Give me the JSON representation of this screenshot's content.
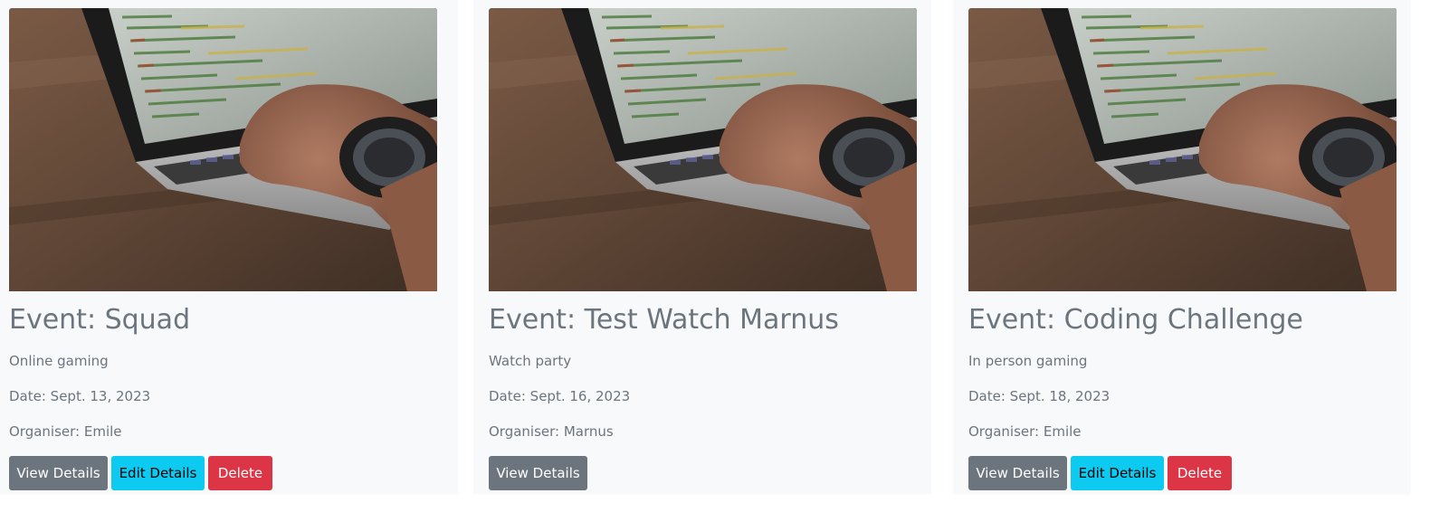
{
  "events": [
    {
      "title": "Event: Squad",
      "description": "Online gaming",
      "date": "Date: Sept. 13, 2023",
      "organiser": "Organiser: Emile",
      "buttons": {
        "view": "View Details",
        "edit": "Edit Details",
        "delete": "Delete"
      }
    },
    {
      "title": "Event: Test Watch Marnus",
      "description": "Watch party",
      "date": "Date: Sept. 16, 2023",
      "organiser": "Organiser: Marnus",
      "buttons": {
        "view": "View Details"
      }
    },
    {
      "title": "Event: Coding Challenge",
      "description": "In person gaming",
      "date": "Date: Sept. 18, 2023",
      "organiser": "Organiser: Emile",
      "buttons": {
        "view": "View Details",
        "edit": "Edit Details",
        "delete": "Delete"
      }
    }
  ],
  "colors": {
    "card_bg": "#f8f9fa",
    "text_muted": "#6c757d",
    "btn_secondary": "#6c757d",
    "btn_info": "#0dcaf0",
    "btn_danger": "#dc3545"
  },
  "image_icon": "laptop-coding-photo"
}
